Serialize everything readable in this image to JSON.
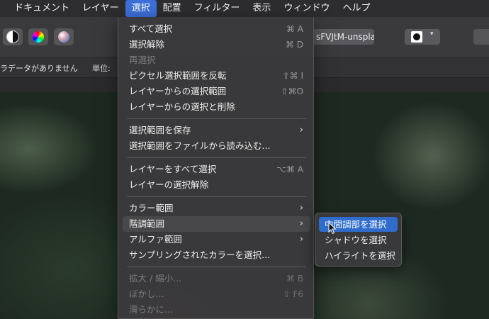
{
  "menubar": {
    "items": [
      "ドキュメント",
      "レイヤー",
      "選択",
      "配置",
      "フィルター",
      "表示",
      "ウィンドウ",
      "ヘルプ"
    ],
    "active_index": 2
  },
  "toolbar": {
    "document_tab": "sFVJtM-unspla",
    "shape_arrow": "▾"
  },
  "options": {
    "metadata_text": "ラデータがありません",
    "unit_label": "単位:"
  },
  "select_menu": {
    "items": [
      {
        "label": "すべて選択",
        "shortcut": "⌘ A",
        "enabled": true
      },
      {
        "label": "選択解除",
        "shortcut": "⌘ D",
        "enabled": true
      },
      {
        "label": "再選択",
        "shortcut": "",
        "enabled": false
      },
      {
        "label": "ピクセル選択範囲を反転",
        "shortcut": "⇧⌘ I",
        "enabled": true
      },
      {
        "label": "レイヤーからの選択範囲",
        "shortcut": "⇧⌘O",
        "enabled": true
      },
      {
        "label": "レイヤーからの選択と削除",
        "shortcut": "",
        "enabled": true
      },
      {
        "label": "選択範囲を保存",
        "submenu": true,
        "enabled": true
      },
      {
        "label": "選択範囲をファイルから読み込む...",
        "shortcut": "",
        "enabled": true
      },
      {
        "label": "レイヤーをすべて選択",
        "shortcut": "⌥⌘ A",
        "enabled": true
      },
      {
        "label": "レイヤーの選択解除",
        "shortcut": "",
        "enabled": true
      },
      {
        "label": "カラー範囲",
        "submenu": true,
        "enabled": true
      },
      {
        "label": "階調範囲",
        "submenu": true,
        "enabled": true,
        "highlighted": true
      },
      {
        "label": "アルファ範囲",
        "submenu": true,
        "enabled": true
      },
      {
        "label": "サンプリングされたカラーを選択...",
        "shortcut": "",
        "enabled": true
      },
      {
        "label": "拡大 / 縮小...",
        "shortcut": "⌘ B",
        "enabled": false
      },
      {
        "label": "ぼかし...",
        "shortcut": "⇧ F6",
        "enabled": false
      },
      {
        "label": "滑らかに...",
        "shortcut": "",
        "enabled": false
      }
    ],
    "chevron": "›"
  },
  "tonal_submenu": {
    "items": [
      "中間調部を選択",
      "シャドウを選択",
      "ハイライトを選択"
    ],
    "selected_index": 0
  },
  "colors": {
    "accent": "#2f6ccc",
    "menubar_active": "#3d6fd8"
  }
}
